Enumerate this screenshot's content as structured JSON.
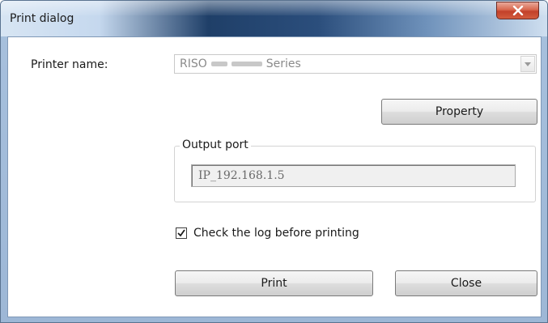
{
  "window": {
    "title": "Print dialog",
    "close_icon": "close-x-icon"
  },
  "printer": {
    "label": "Printer name:",
    "selected_value_prefix": "RISO",
    "selected_value_suffix": "Series",
    "dropdown_icon": "chevron-down-icon"
  },
  "property_button": {
    "label": "Property"
  },
  "output_port": {
    "legend": "Output port",
    "value": "IP_192.168.1.5"
  },
  "log_check": {
    "label": "Check the log before printing",
    "checked": true
  },
  "actions": {
    "print_label": "Print",
    "close_label": "Close"
  },
  "colors": {
    "close_button": "#c2412a",
    "title_bar": "#2b4e7c"
  }
}
